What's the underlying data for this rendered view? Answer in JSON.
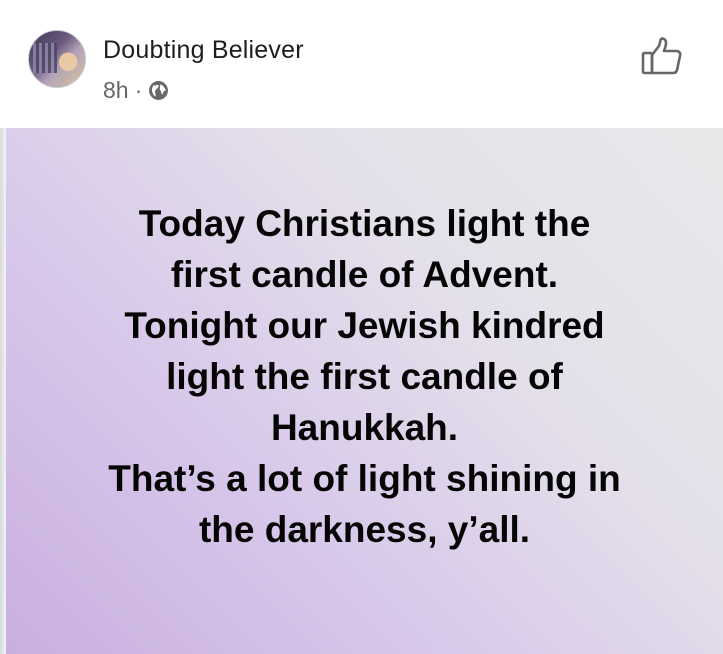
{
  "post": {
    "author": "Doubting Believer",
    "time": "8h",
    "separator": "·",
    "audience_icon": "globe-icon",
    "action_icon": "thumbs-up-icon",
    "text_lines": [
      "Today Christians light the",
      "first candle of Advent.",
      "Tonight our Jewish kindred",
      "light the first candle of",
      "Hanukkah.",
      "That’s a lot of light shining in",
      "the darkness, y’all."
    ],
    "background_colors": [
      "#c9afe0",
      "#e8e8ea"
    ]
  }
}
